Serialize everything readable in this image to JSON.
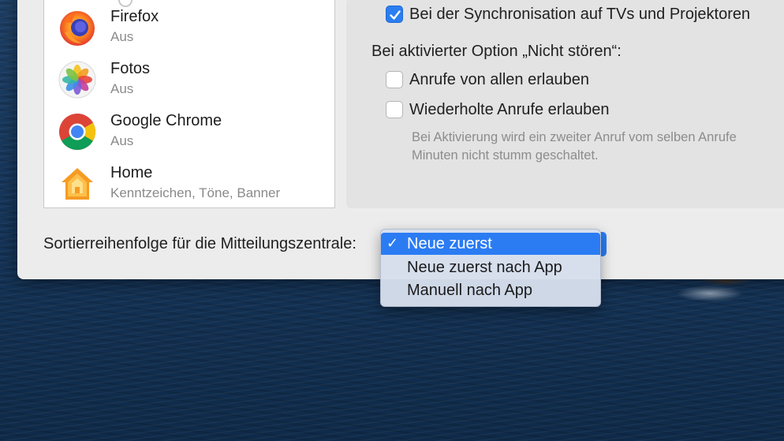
{
  "apps": [
    {
      "name": "Firefox",
      "subtitle": "Aus",
      "icon": "firefox-icon"
    },
    {
      "name": "Fotos",
      "subtitle": "Aus",
      "icon": "photos-icon"
    },
    {
      "name": "Google Chrome",
      "subtitle": "Aus",
      "icon": "chrome-icon"
    },
    {
      "name": "Home",
      "subtitle": "Kenntzeichen, Töne, Banner",
      "icon": "home-icon"
    }
  ],
  "settings": {
    "sync_tv_label": "Bei der Synchronisation auf TVs und Projektoren",
    "sync_tv_checked": true,
    "dnd_heading": "Bei aktivierter Option „Nicht stören“:",
    "allow_all_calls_label": "Anrufe von allen erlauben",
    "allow_all_calls_checked": false,
    "repeated_calls_label": "Wiederholte Anrufe erlauben",
    "repeated_calls_checked": false,
    "hint_line1": "Bei Aktivierung wird ein zweiter Anruf vom selben Anrufe",
    "hint_line2": "Minuten nicht stumm geschaltet."
  },
  "sort": {
    "label": "Sortierreihenfolge für die Mitteilungszentrale:",
    "selected": "Neue zuerst",
    "options": [
      "Neue zuerst",
      "Neue zuerst nach App",
      "Manuell nach App"
    ],
    "check_glyph": "✓"
  },
  "colors": {
    "accent": "#2b7cf3",
    "window": "#ececec"
  }
}
